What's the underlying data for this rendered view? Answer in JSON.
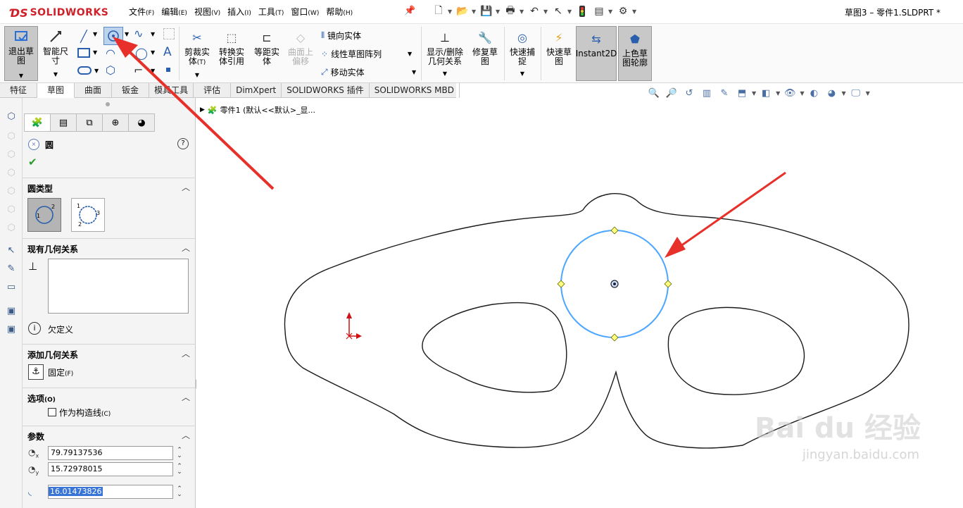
{
  "app": {
    "logo_ds": "ƊS",
    "logo_name": "SOLIDWORKS",
    "doc_title": "草图3 – 零件1.SLDPRT *"
  },
  "menu": [
    {
      "label": "文件",
      "key": "(F)"
    },
    {
      "label": "编辑",
      "key": "(E)"
    },
    {
      "label": "视图",
      "key": "(V)"
    },
    {
      "label": "插入",
      "key": "(I)"
    },
    {
      "label": "工具",
      "key": "(T)"
    },
    {
      "label": "窗口",
      "key": "(W)"
    },
    {
      "label": "帮助",
      "key": "(H)"
    }
  ],
  "ribbon": {
    "exit_sketch": "退出草图",
    "smart_dim": "智能尺寸",
    "trim": "剪裁实体",
    "trim_key": "(T)",
    "convert": "转换实体引用",
    "offset": "等距实体",
    "surface_offset": "曲面上偏移",
    "mirror": "镜向实体",
    "linear_pattern": "线性草图阵列",
    "move": "移动实体",
    "show_relations": "显示/删除几何关系",
    "repair": "修复草图",
    "quick_snap": "快速捕捉",
    "rapid_sketch": "快速草图",
    "instant2d": "Instant2D",
    "shaded": "上色草图轮廓"
  },
  "tabs": [
    "特征",
    "草图",
    "曲面",
    "钣金",
    "模具工具",
    "评估",
    "DimXpert",
    "SOLIDWORKS 插件",
    "SOLIDWORKS MBD"
  ],
  "tree": {
    "item": "零件1 (默认<<默认>_显..."
  },
  "pm": {
    "title": "圆",
    "circle_type_header": "圆类型",
    "existing_rel_header": "现有几何关系",
    "under_defined": "欠定义",
    "add_rel_header": "添加几何关系",
    "fix": "固定",
    "fix_key": "(F)",
    "options_header": "选项",
    "options_key": "(O)",
    "construction": "作为构造线",
    "construction_key": "(C)",
    "params_header": "参数",
    "cx": "79.79137536",
    "cy": "15.72978015",
    "radius": "16.01473826"
  },
  "watermark": {
    "brand": "Bai du 经验",
    "url": "jingyan.baidu.com"
  },
  "colors": {
    "accent": "#4da6ff",
    "arrow": "#e8302a",
    "sketch": "#1a1a1a"
  }
}
